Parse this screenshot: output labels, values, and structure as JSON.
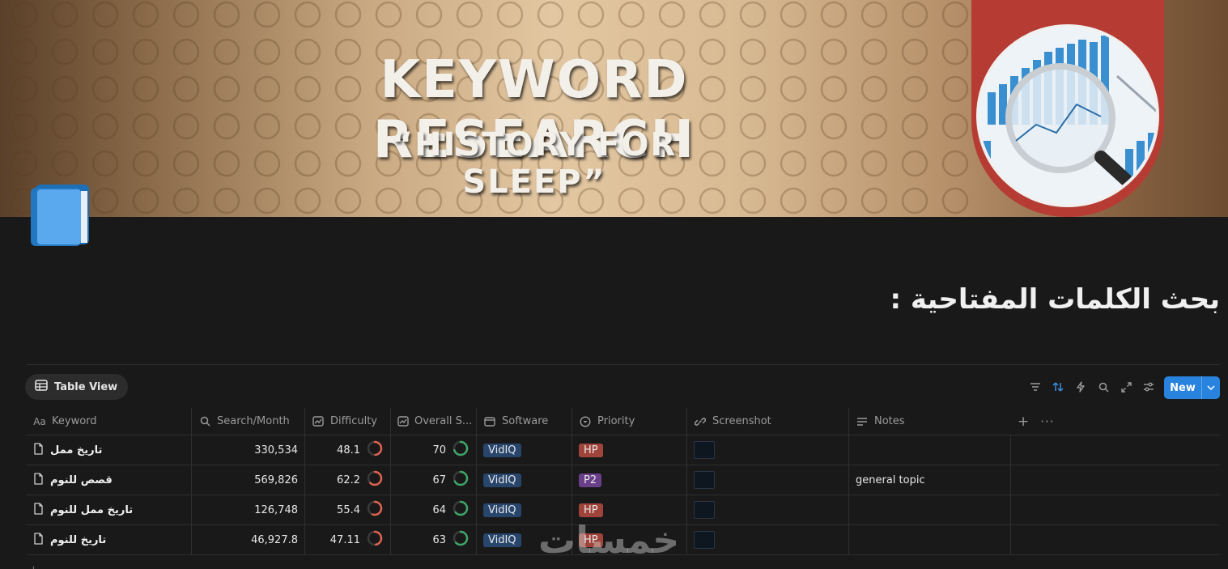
{
  "cover": {
    "title": "KEYWORD RESEARCH",
    "subtitle": "“HISTORY FOR SLEEP”",
    "accent_color": "#b63c33"
  },
  "page": {
    "icon": "book-icon",
    "title": "بحث الكلمات المفتاحية :"
  },
  "view": {
    "tab_label": "Table View",
    "new_label": "New",
    "accent": "#2783de"
  },
  "columns": [
    {
      "label": "Keyword",
      "icon": "title-icon"
    },
    {
      "label": "Search/Month",
      "icon": "search-icon"
    },
    {
      "label": "Difficulty",
      "icon": "chart-icon"
    },
    {
      "label": "Overall S...",
      "icon": "chart-icon"
    },
    {
      "label": "Software",
      "icon": "window-icon"
    },
    {
      "label": "Priority",
      "icon": "select-icon"
    },
    {
      "label": "Screenshot",
      "icon": "link-icon"
    },
    {
      "label": "Notes",
      "icon": "text-icon"
    }
  ],
  "rows": [
    {
      "keyword": "تاريخ ممل",
      "search": "330,534",
      "difficulty": "48.1",
      "difficulty_pct": 48.1,
      "overall": "70",
      "overall_pct": 70,
      "software": "VidIQ",
      "priority": "HP",
      "notes": ""
    },
    {
      "keyword": "قصص للنوم",
      "search": "569,826",
      "difficulty": "62.2",
      "difficulty_pct": 62.2,
      "overall": "67",
      "overall_pct": 67,
      "software": "VidIQ",
      "priority": "P2",
      "notes": "general topic"
    },
    {
      "keyword": "تاريخ ممل للنوم",
      "search": "126,748",
      "difficulty": "55.4",
      "difficulty_pct": 55.4,
      "overall": "64",
      "overall_pct": 64,
      "software": "VidIQ",
      "priority": "HP",
      "notes": ""
    },
    {
      "keyword": "تاريخ للنوم",
      "search": "46,927.8",
      "difficulty": "47.11",
      "difficulty_pct": 47.11,
      "overall": "63",
      "overall_pct": 63,
      "software": "VidIQ",
      "priority": "HP",
      "notes": ""
    }
  ],
  "colors": {
    "difficulty_ring": "#e0624f",
    "overall_ring": "#3fa46a",
    "hp": "#a0443b",
    "p2": "#6a3f8a",
    "vidiq": "#28456c"
  },
  "watermark": "خمسات"
}
